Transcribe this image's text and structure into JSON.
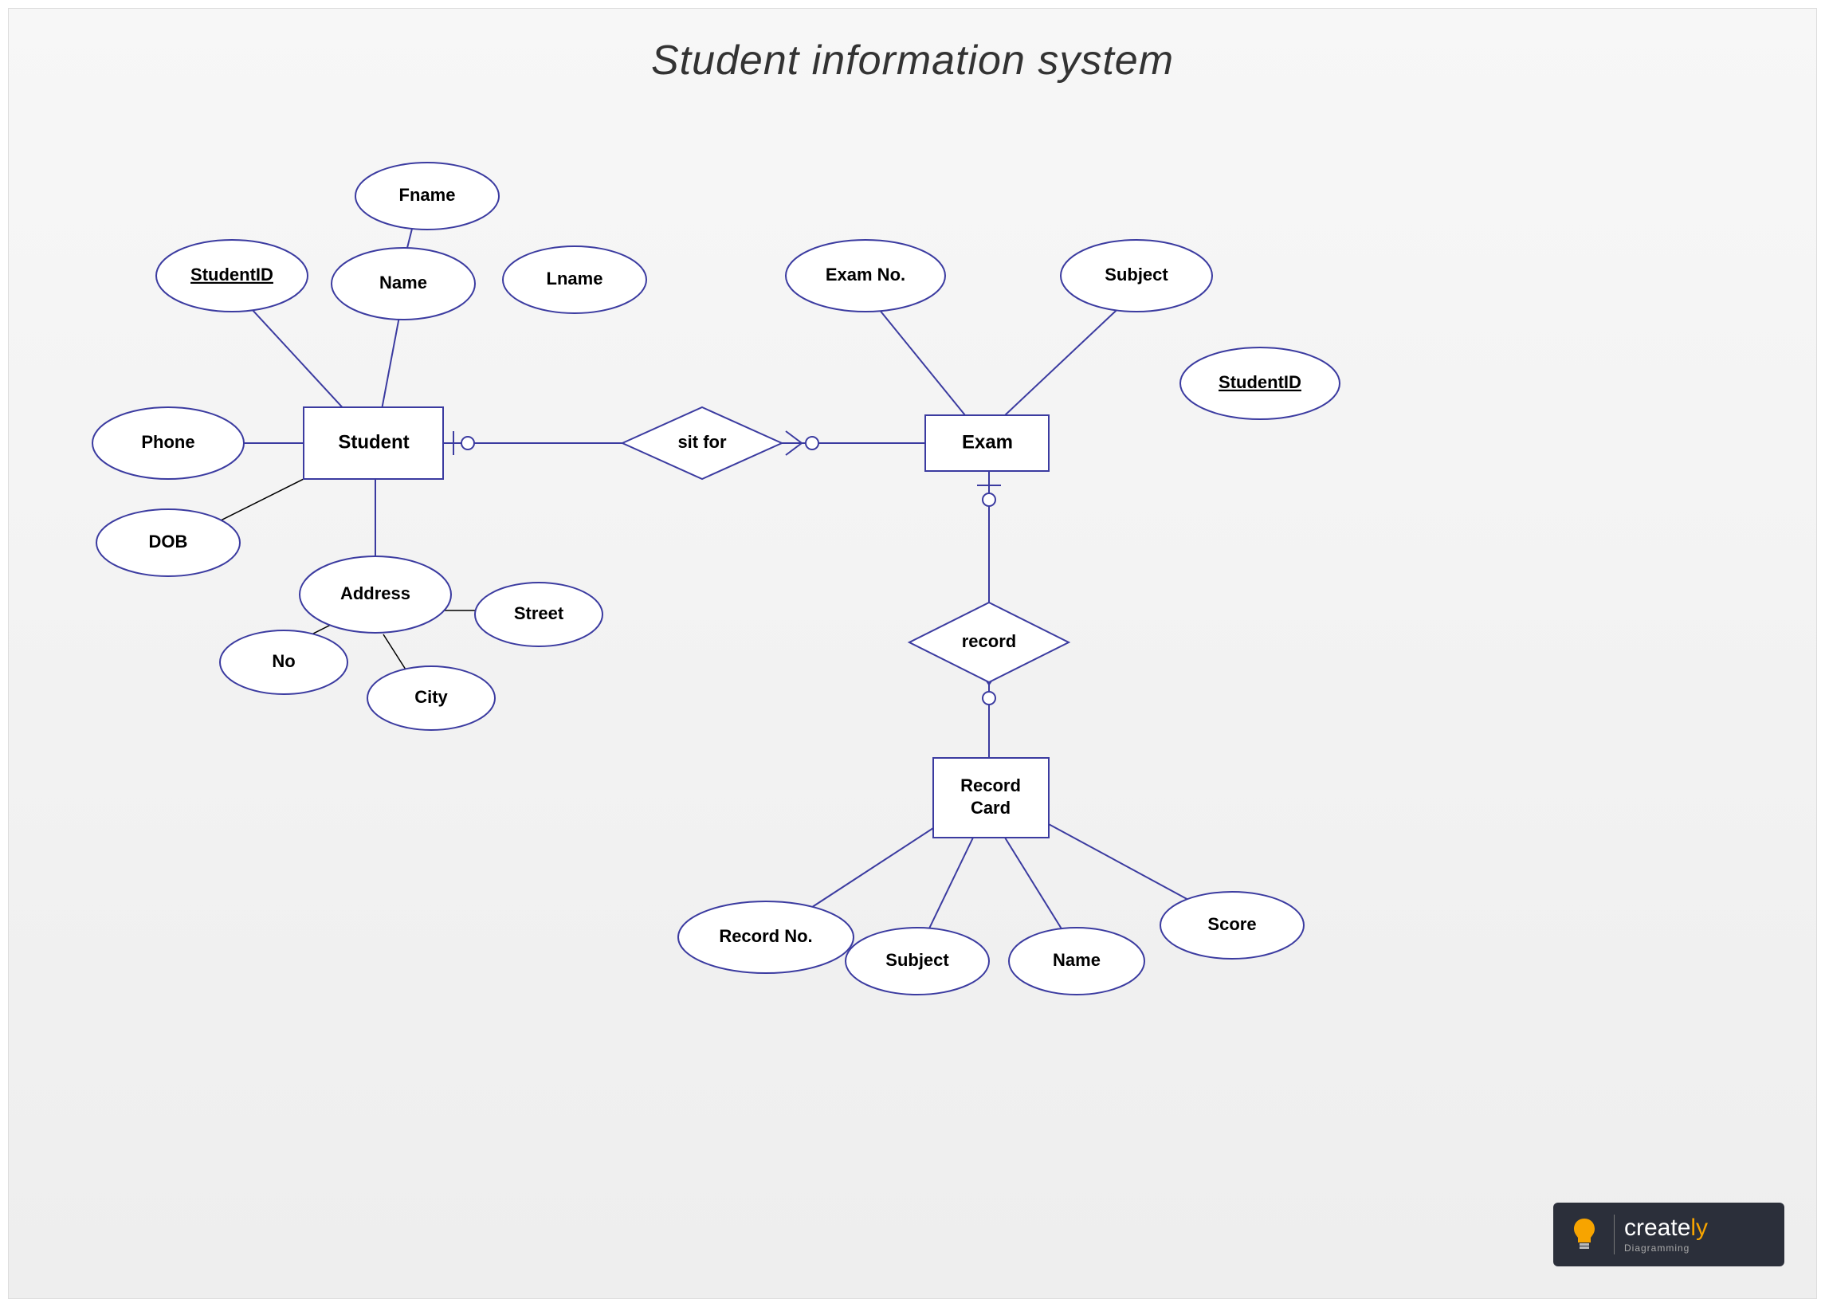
{
  "title": "Student information system",
  "entities": {
    "student": "Student",
    "exam": "Exam",
    "recordcard_l1": "Record",
    "recordcard_l2": "Card"
  },
  "relationships": {
    "sitfor": "sit for",
    "record": "record"
  },
  "attributes": {
    "student_id": "StudentID",
    "phone": "Phone",
    "dob": "DOB",
    "name": "Name",
    "fname": "Fname",
    "lname": "Lname",
    "address": "Address",
    "no": "No",
    "city": "City",
    "street": "Street",
    "exam_no": "Exam No.",
    "subject_exam": "Subject",
    "student_id_exam": "StudentID",
    "record_no": "Record No.",
    "subject_rec": "Subject",
    "name_rec": "Name",
    "score": "Score"
  },
  "logo": {
    "name": "create",
    "accent": "ly",
    "tagline": "Diagramming"
  }
}
